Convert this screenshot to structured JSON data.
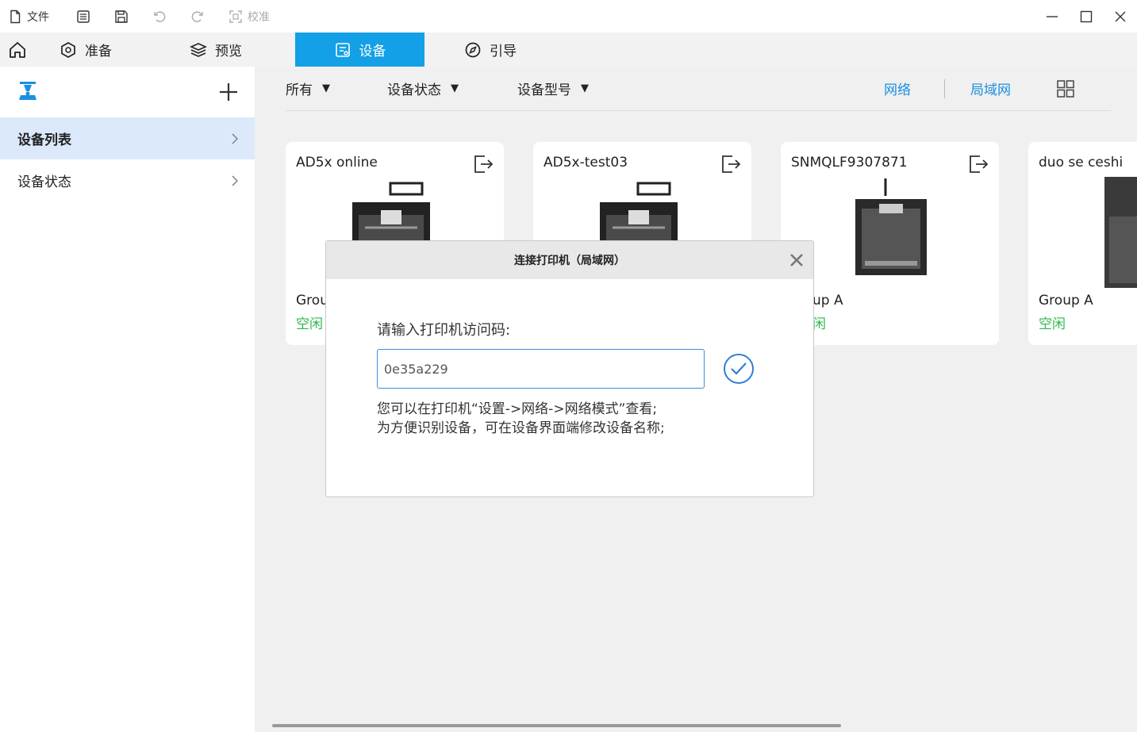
{
  "toolbar": {
    "file_label": "文件",
    "calibrate_label": "校准"
  },
  "nav": {
    "tabs": [
      {
        "label": "准备"
      },
      {
        "label": "预览"
      },
      {
        "label": "设备"
      },
      {
        "label": "引导"
      }
    ],
    "active_tab": "设备"
  },
  "sidebar": {
    "items": [
      {
        "label": "设备列表",
        "active": true
      },
      {
        "label": "设备状态",
        "active": false
      }
    ]
  },
  "filters": {
    "all": "所有",
    "status": "设备状态",
    "model": "设备型号",
    "network": "网络",
    "lan": "局域网"
  },
  "devices": [
    {
      "name": "AD5x online",
      "group": "Group A",
      "status": "空闲",
      "visible_group": "Grou",
      "visible_status": "空闲"
    },
    {
      "name": "AD5x-test03",
      "group": "",
      "status": ""
    },
    {
      "name": "SNMQLF9307871",
      "visible_group": "up A",
      "visible_status": "闲"
    },
    {
      "name": "duo se ceshi",
      "group": "Group A",
      "status": "空闲"
    }
  ],
  "dialog": {
    "title": "连接打印机（局域网）",
    "prompt": "请输入打印机访问码:",
    "input_value": "0e35a229",
    "help_line1": "您可以在打印机“设置->网络->网络模式”查看;",
    "help_line2": "为方便识别设备，可在设备界面端修改设备名称;"
  },
  "colors": {
    "accent": "#14a0e6",
    "link": "#1a8fe0",
    "status_idle": "#2db84c",
    "sidebar_active": "#dbe9fb"
  }
}
